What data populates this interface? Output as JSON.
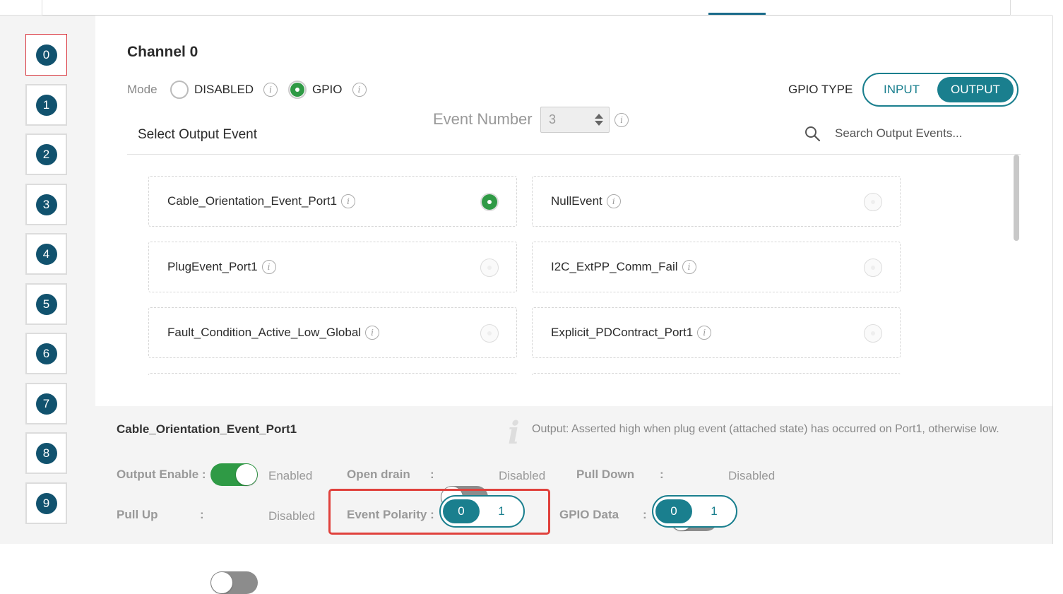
{
  "sidebar": {
    "channels": [
      "0",
      "1",
      "2",
      "3",
      "4",
      "5",
      "6",
      "7",
      "8",
      "9"
    ],
    "active_index": 0
  },
  "main": {
    "title": "Channel 0",
    "mode": {
      "label": "Mode",
      "options": [
        {
          "label": "DISABLED",
          "selected": false
        },
        {
          "label": "GPIO",
          "selected": true
        }
      ]
    },
    "gpio_type": {
      "label": "GPIO TYPE",
      "options": [
        "INPUT",
        "OUTPUT"
      ],
      "selected": "OUTPUT"
    },
    "event_number": {
      "label": "Event Number",
      "value": "3"
    },
    "select_output_event_label": "Select Output Event",
    "search": {
      "placeholder": "Search Output Events..."
    },
    "events": [
      {
        "name": "Cable_Orientation_Event_Port1",
        "selected": true
      },
      {
        "name": "NullEvent",
        "selected": false
      },
      {
        "name": "PlugEvent_Port1",
        "selected": false
      },
      {
        "name": "I2C_ExtPP_Comm_Fail",
        "selected": false
      },
      {
        "name": "Fault_Condition_Active_Low_Global",
        "selected": false
      },
      {
        "name": "Explicit_PDContract_Port1",
        "selected": false
      }
    ]
  },
  "config": {
    "selected_event": "Cable_Orientation_Event_Port1",
    "description": "Output: Asserted high when plug event (attached state) has occurred on Port1, otherwise low.",
    "output_enable": {
      "label": "Output Enable :",
      "state": "Enabled",
      "on": true
    },
    "open_drain": {
      "label": "Open drain",
      "colon": ":",
      "state": "Disabled",
      "on": false
    },
    "pull_down": {
      "label": "Pull Down",
      "colon": ":",
      "state": "Disabled",
      "on": false
    },
    "pull_up": {
      "label": "Pull Up",
      "colon": ":",
      "state": "Disabled",
      "on": false
    },
    "event_polarity": {
      "label": "Event Polarity :",
      "options": [
        "0",
        "1"
      ],
      "selected": "0"
    },
    "gpio_data": {
      "label": "GPIO Data",
      "colon": ":",
      "options": [
        "0",
        "1"
      ],
      "selected": "0"
    }
  },
  "colors": {
    "accent": "#1a7f8e",
    "channel_badge": "#11526e",
    "selected_green": "#2f9a45",
    "highlight_red": "#e0413c"
  }
}
